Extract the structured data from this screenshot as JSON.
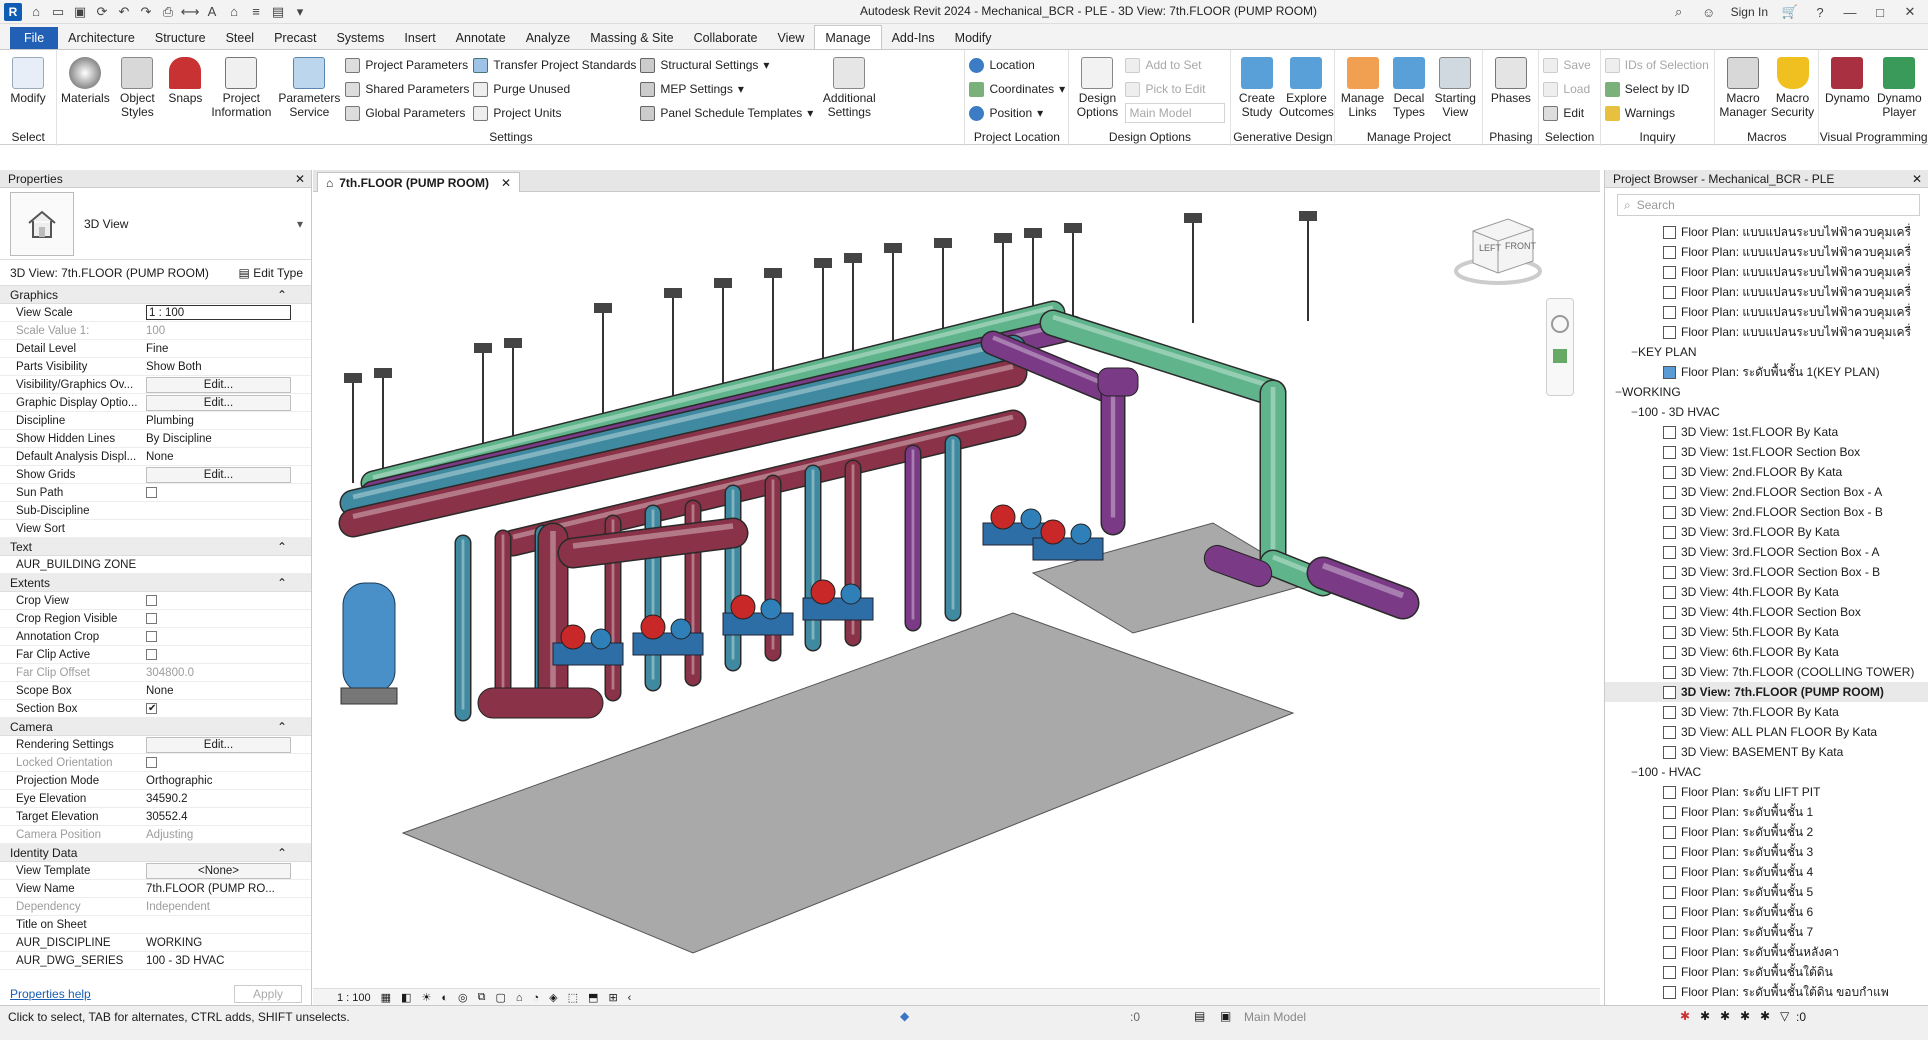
{
  "titlebar": {
    "title": "Autodesk Revit 2024 - Mechanical_BCR - PLE - 3D View: 7th.FLOOR (PUMP ROOM)",
    "sign_in": "Sign In"
  },
  "tabs": [
    "File",
    "Architecture",
    "Structure",
    "Steel",
    "Precast",
    "Systems",
    "Insert",
    "Annotate",
    "Analyze",
    "Massing & Site",
    "Collaborate",
    "View",
    "Manage",
    "Add-Ins",
    "Modify"
  ],
  "active_tab": "Manage",
  "ribbon": {
    "select": {
      "modify": "Modify",
      "label": "Select"
    },
    "settings": {
      "materials": "Materials",
      "object_styles": "Object Styles",
      "snaps": "Snaps",
      "project_information": "Project Information",
      "parameters_service": "Parameters Service",
      "project_parameters": "Project Parameters",
      "shared_parameters": "Shared Parameters",
      "global_parameters": "Global Parameters",
      "transfer_standards": "Transfer Project Standards",
      "purge_unused": "Purge Unused",
      "project_units": "Project Units",
      "structural_settings": "Structural Settings",
      "mep_settings": "MEP Settings",
      "panel_schedule_templates": "Panel Schedule Templates",
      "additional_settings": "Additional Settings",
      "label": "Settings"
    },
    "project_location": {
      "location": "Location",
      "coordinates": "Coordinates",
      "position": "Position",
      "label": "Project Location"
    },
    "design_options": {
      "design_options": "Design Options",
      "add_to_set": "Add to Set",
      "pick_to_edit": "Pick to Edit",
      "main_model": "Main Model",
      "label": "Design Options"
    },
    "generative": {
      "create_study": "Create Study",
      "explore_outcomes": "Explore Outcomes",
      "label": "Generative Design"
    },
    "manage_project": {
      "manage_links": "Manage Links",
      "decal_types": "Decal Types",
      "starting_view": "Starting View",
      "label": "Manage Project"
    },
    "phasing": {
      "phases": "Phases",
      "label": "Phasing"
    },
    "selection": {
      "save": "Save",
      "load": "Load",
      "edit": "Edit",
      "label": "Selection"
    },
    "inquiry": {
      "ids_of_selection": "IDs of Selection",
      "select_by_id": "Select by ID",
      "warnings": "Warnings",
      "label": "Inquiry"
    },
    "macros": {
      "macro_manager": "Macro Manager",
      "macro_security": "Macro Security",
      "label": "Macros"
    },
    "visual_programming": {
      "dynamo": "Dynamo",
      "dynamo_player": "Dynamo Player",
      "label": "Visual Programming"
    }
  },
  "properties": {
    "header": "Properties",
    "type_name": "3D View",
    "view_selector": "3D View: 7th.FLOOR (PUMP ROOM)",
    "edit_type": "Edit Type",
    "sections": [
      {
        "title": "Graphics",
        "rows": [
          {
            "k": "View Scale",
            "v": "1 : 100",
            "kind": "input"
          },
          {
            "k": "Scale Value    1:",
            "v": "100",
            "kind": "dim"
          },
          {
            "k": "Detail Level",
            "v": "Fine"
          },
          {
            "k": "Parts Visibility",
            "v": "Show Both"
          },
          {
            "k": "Visibility/Graphics Ov...",
            "v": "Edit...",
            "kind": "btn"
          },
          {
            "k": "Graphic Display Optio...",
            "v": "Edit...",
            "kind": "btn"
          },
          {
            "k": "Discipline",
            "v": "Plumbing"
          },
          {
            "k": "Show Hidden Lines",
            "v": "By Discipline"
          },
          {
            "k": "Default Analysis Displ...",
            "v": "None"
          },
          {
            "k": "Show Grids",
            "v": "Edit...",
            "kind": "btn"
          },
          {
            "k": "Sun Path",
            "v": "",
            "kind": "chk"
          },
          {
            "k": "Sub-Discipline",
            "v": ""
          },
          {
            "k": "View Sort",
            "v": ""
          }
        ]
      },
      {
        "title": "Text",
        "rows": [
          {
            "k": "AUR_BUILDING ZONE",
            "v": ""
          }
        ]
      },
      {
        "title": "Extents",
        "rows": [
          {
            "k": "Crop View",
            "v": "",
            "kind": "chk"
          },
          {
            "k": "Crop Region Visible",
            "v": "",
            "kind": "chk"
          },
          {
            "k": "Annotation Crop",
            "v": "",
            "kind": "chk"
          },
          {
            "k": "Far Clip Active",
            "v": "",
            "kind": "chk"
          },
          {
            "k": "Far Clip Offset",
            "v": "304800.0",
            "kind": "dim"
          },
          {
            "k": "Scope Box",
            "v": "None"
          },
          {
            "k": "Section Box",
            "v": "",
            "kind": "chkon"
          }
        ]
      },
      {
        "title": "Camera",
        "rows": [
          {
            "k": "Rendering Settings",
            "v": "Edit...",
            "kind": "btn"
          },
          {
            "k": "Locked Orientation",
            "v": "",
            "kind": "dimchk"
          },
          {
            "k": "Projection Mode",
            "v": "Orthographic"
          },
          {
            "k": "Eye Elevation",
            "v": "34590.2"
          },
          {
            "k": "Target Elevation",
            "v": "30552.4"
          },
          {
            "k": "Camera Position",
            "v": "Adjusting",
            "kind": "dim"
          }
        ]
      },
      {
        "title": "Identity Data",
        "rows": [
          {
            "k": "View Template",
            "v": "<None>",
            "kind": "btn"
          },
          {
            "k": "View Name",
            "v": "7th.FLOOR (PUMP RO..."
          },
          {
            "k": "Dependency",
            "v": "Independent",
            "kind": "dim"
          },
          {
            "k": "Title on Sheet",
            "v": ""
          },
          {
            "k": "AUR_DISCIPLINE",
            "v": "WORKING"
          },
          {
            "k": "AUR_DWG_SERIES",
            "v": "100 - 3D HVAC"
          }
        ]
      }
    ],
    "help": "Properties help",
    "apply": "Apply"
  },
  "view": {
    "tab_label": "7th.FLOOR (PUMP ROOM)",
    "scale": "1 : 100",
    "viewcube_left": "LEFT",
    "viewcube_front": "FRONT"
  },
  "browser": {
    "header": "Project Browser - Mechanical_BCR - PLE",
    "search_placeholder": "Search",
    "items": [
      {
        "t": "Floor Plan: แบบแปลนระบบไฟฟ้าควบคุมเครื่",
        "lvl": 3
      },
      {
        "t": "Floor Plan: แบบแปลนระบบไฟฟ้าควบคุมเครื่",
        "lvl": 3
      },
      {
        "t": "Floor Plan: แบบแปลนระบบไฟฟ้าควบคุมเครื่",
        "lvl": 3
      },
      {
        "t": "Floor Plan: แบบแปลนระบบไฟฟ้าควบคุมเครื่",
        "lvl": 3
      },
      {
        "t": "Floor Plan: แบบแปลนระบบไฟฟ้าควบคุมเครื่",
        "lvl": 3
      },
      {
        "t": "Floor Plan: แบบแปลนระบบไฟฟ้าควบคุมเครื่",
        "lvl": 3
      },
      {
        "t": "KEY PLAN",
        "lvl": 2,
        "group": true
      },
      {
        "t": "Floor Plan: ระดับพื้นชั้น 1(KEY PLAN)",
        "lvl": 3,
        "blue": true
      },
      {
        "t": "WORKING",
        "lvl": 1,
        "group": true
      },
      {
        "t": "100 - 3D HVAC",
        "lvl": 2,
        "group": true
      },
      {
        "t": "3D View: 1st.FLOOR By Kata",
        "lvl": 3
      },
      {
        "t": "3D View: 1st.FLOOR Section Box",
        "lvl": 3
      },
      {
        "t": "3D View: 2nd.FLOOR By Kata",
        "lvl": 3
      },
      {
        "t": "3D View: 2nd.FLOOR Section Box - A",
        "lvl": 3
      },
      {
        "t": "3D View: 2nd.FLOOR Section Box - B",
        "lvl": 3
      },
      {
        "t": "3D View: 3rd.FLOOR By Kata",
        "lvl": 3
      },
      {
        "t": "3D View: 3rd.FLOOR Section Box - A",
        "lvl": 3
      },
      {
        "t": "3D View: 3rd.FLOOR Section Box - B",
        "lvl": 3
      },
      {
        "t": "3D View: 4th.FLOOR By Kata",
        "lvl": 3
      },
      {
        "t": "3D View: 4th.FLOOR Section Box",
        "lvl": 3
      },
      {
        "t": "3D View: 5th.FLOOR By Kata",
        "lvl": 3
      },
      {
        "t": "3D View: 6th.FLOOR By Kata",
        "lvl": 3
      },
      {
        "t": "3D View: 7th.FLOOR (COOLLING TOWER)",
        "lvl": 3
      },
      {
        "t": "3D View: 7th.FLOOR (PUMP ROOM)",
        "lvl": 3,
        "selected": true
      },
      {
        "t": "3D View: 7th.FLOOR By Kata",
        "lvl": 3
      },
      {
        "t": "3D View: ALL PLAN FLOOR By Kata",
        "lvl": 3
      },
      {
        "t": "3D View: BASEMENT By Kata",
        "lvl": 3
      },
      {
        "t": "100 - HVAC",
        "lvl": 2,
        "group": true
      },
      {
        "t": "Floor Plan: ระดับ LIFT PIT",
        "lvl": 3
      },
      {
        "t": "Floor Plan: ระดับพื้นชั้น 1",
        "lvl": 3
      },
      {
        "t": "Floor Plan: ระดับพื้นชั้น 2",
        "lvl": 3
      },
      {
        "t": "Floor Plan: ระดับพื้นชั้น 3",
        "lvl": 3
      },
      {
        "t": "Floor Plan: ระดับพื้นชั้น 4",
        "lvl": 3
      },
      {
        "t": "Floor Plan: ระดับพื้นชั้น 5",
        "lvl": 3
      },
      {
        "t": "Floor Plan: ระดับพื้นชั้น 6",
        "lvl": 3
      },
      {
        "t": "Floor Plan: ระดับพื้นชั้น 7",
        "lvl": 3
      },
      {
        "t": "Floor Plan: ระดับพื้นชั้นหลังคา",
        "lvl": 3
      },
      {
        "t": "Floor Plan: ระดับพื้นชั้นใต้ดิน",
        "lvl": 3
      },
      {
        "t": "Floor Plan: ระดับพื้นชั้นใต้ดิน ขอบกำแพ",
        "lvl": 3
      }
    ]
  },
  "status": {
    "hint": "Click to select, TAB for alternates, CTRL adds, SHIFT unselects.",
    "selection_count": ":0",
    "model": "Main Model",
    "filter_count": ":0"
  },
  "colors": {
    "pipe_green": "#5fb48c",
    "pipe_purple": "#7a3a86",
    "pipe_maroon": "#8a3248",
    "pipe_teal": "#3f8aa0",
    "tank_blue": "#4a90c8",
    "file_tab": "#2160b5"
  }
}
